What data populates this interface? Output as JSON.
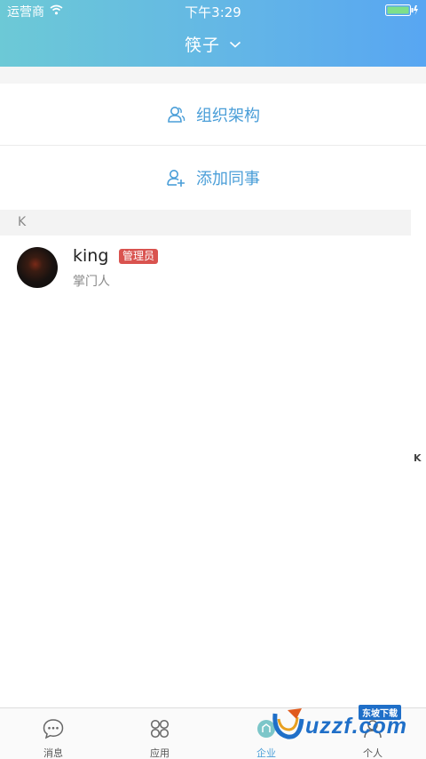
{
  "status_bar": {
    "carrier": "运营商",
    "time": "下午3:29"
  },
  "header": {
    "title": "筷子"
  },
  "actions": {
    "org_structure": "组织架构",
    "add_colleague": "添加同事"
  },
  "section": {
    "letter": "K"
  },
  "contacts": [
    {
      "name": "king",
      "badge": "管理员",
      "role": "掌门人"
    }
  ],
  "index_bar": {
    "letters": [
      "K"
    ]
  },
  "tabs": [
    {
      "label": "消息",
      "icon": "chat-bubble-icon"
    },
    {
      "label": "应用",
      "icon": "apps-grid-icon"
    },
    {
      "label": "企业",
      "icon": "enterprise-icon",
      "active": true
    },
    {
      "label": "个人",
      "icon": "person-icon"
    }
  ],
  "watermark": {
    "brand": "uzzf.com",
    "tag": "东坡下载"
  },
  "colors": {
    "accent": "#4a9ed8",
    "badge": "#d9534f"
  }
}
